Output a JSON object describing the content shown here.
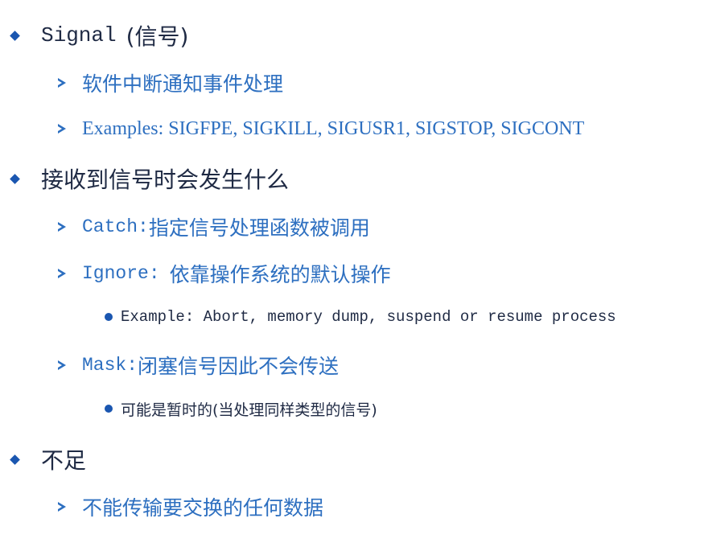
{
  "slide": {
    "items": [
      {
        "level": 1,
        "text_a": "Signal",
        "text_b": "(信号)"
      },
      {
        "level": 2,
        "text": "软件中断通知事件处理"
      },
      {
        "level": 2,
        "text": "Examples: SIGFPE, SIGKILL, SIGUSR1, SIGSTOP, SIGCONT"
      },
      {
        "level": 1,
        "text": "接收到信号时会发生什么"
      },
      {
        "level": 2,
        "text_a": "Catch:",
        "text_b": "指定信号处理函数被调用"
      },
      {
        "level": 2,
        "text_a": "Ignore:",
        "text_b": "依靠操作系统的默认操作"
      },
      {
        "level": 3,
        "text": "Example: Abort, memory dump, suspend or resume process"
      },
      {
        "level": 2,
        "text_a": "Mask:",
        "text_b": "闭塞信号因此不会传送"
      },
      {
        "level": 3,
        "text": "可能是暂时的(当处理同样类型的信号)"
      },
      {
        "level": 1,
        "text": "不足"
      },
      {
        "level": 2,
        "text": "不能传输要交换的任何数据"
      }
    ]
  },
  "colors": {
    "bullet": "#1a56b0",
    "level1_text": "#1f2a44",
    "level2_text": "#2d6fc0",
    "level3_text": "#1f2a44"
  },
  "icons": {
    "level1": "diamond-bullet-icon",
    "level2": "arrow-bullet-icon",
    "level3": "dot-bullet-icon"
  }
}
